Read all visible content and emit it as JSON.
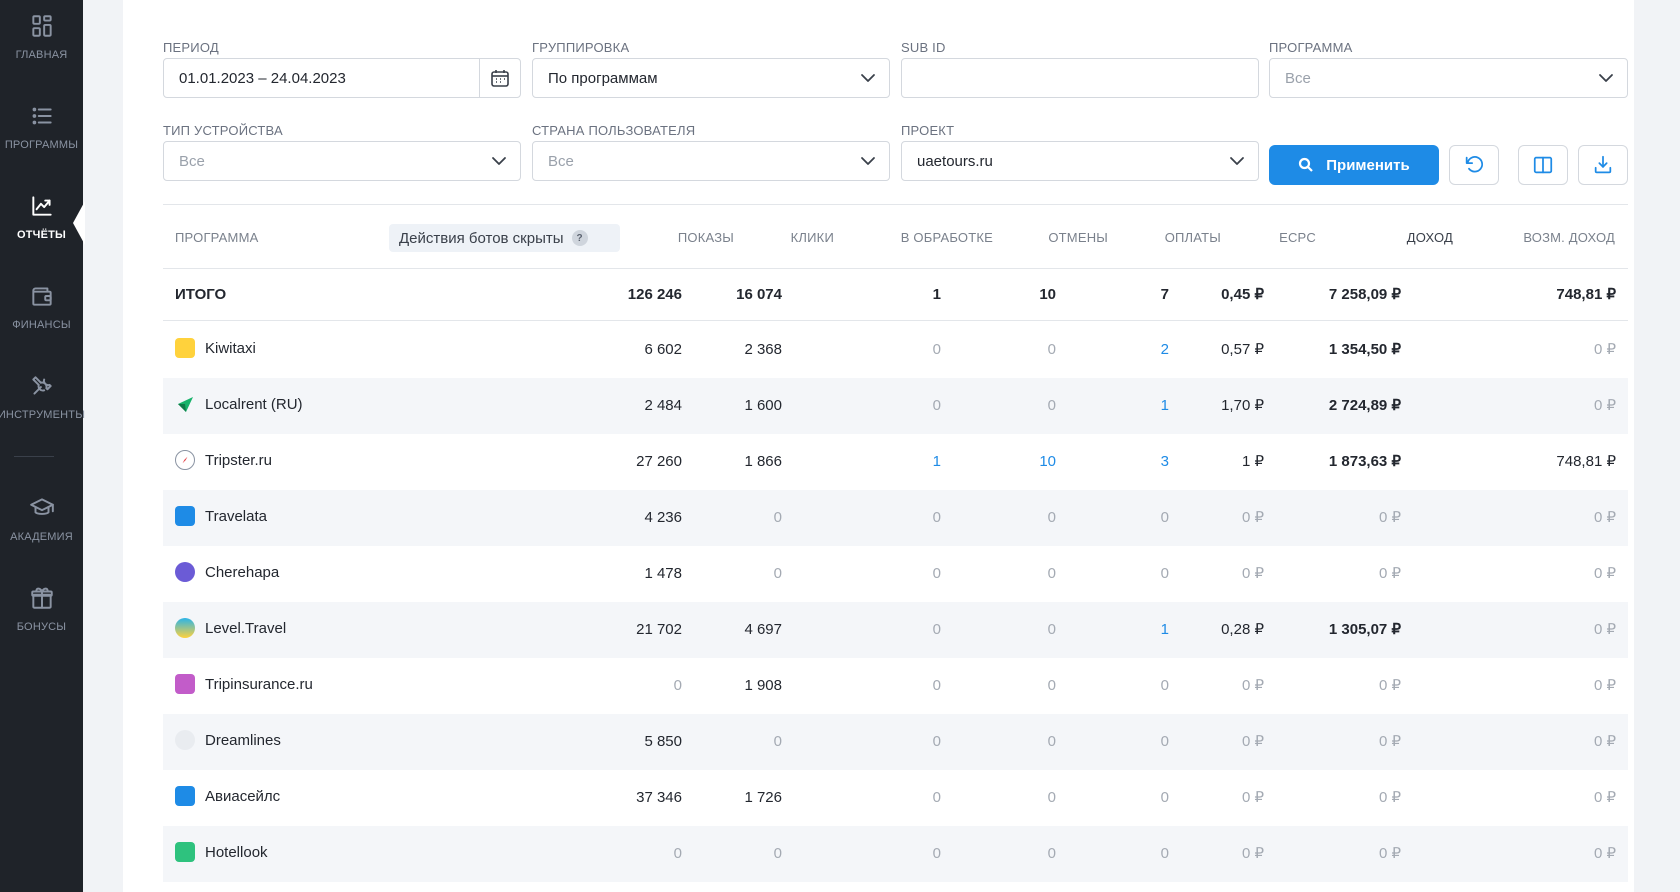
{
  "sidebar": {
    "items": [
      {
        "label": "ГЛАВНАЯ",
        "icon": "dashboard-icon"
      },
      {
        "label": "ПРОГРАММЫ",
        "icon": "list-icon"
      },
      {
        "label": "ОТЧЁТЫ",
        "icon": "chart-icon",
        "active": true
      },
      {
        "label": "ФИНАНСЫ",
        "icon": "wallet-icon"
      },
      {
        "label": "ИНСТРУМЕНТЫ",
        "icon": "tools-icon"
      },
      {
        "label": "АКАДЕМИЯ",
        "icon": "graduation-cap-icon"
      },
      {
        "label": "БОНУСЫ",
        "icon": "gift-icon"
      }
    ]
  },
  "filters": {
    "period": {
      "label": "ПЕРИОД",
      "value": "01.01.2023 – 24.04.2023"
    },
    "grouping": {
      "label": "ГРУППИРОВКА",
      "value": "По программам"
    },
    "subid": {
      "label": "SUB ID",
      "value": ""
    },
    "program": {
      "label": "ПРОГРАММА",
      "placeholder": "Все"
    },
    "device": {
      "label": "ТИП УСТРОЙСТВА",
      "placeholder": "Все"
    },
    "country": {
      "label": "СТРАНА ПОЛЬЗОВАТЕЛЯ",
      "placeholder": "Все"
    },
    "project": {
      "label": "ПРОЕКТ",
      "value": "uaetours.ru"
    },
    "apply_label": "Применить"
  },
  "table": {
    "headers": {
      "program": "ПРОГРАММА",
      "bots": "Действия ботов скрыты",
      "bots_hint": "?",
      "shows": "ПОКАЗЫ",
      "clicks": "КЛИКИ",
      "processing": "В ОБРАБОТКЕ",
      "cancels": "ОТМЕНЫ",
      "payments": "ОПЛАТЫ",
      "ecpc": "ECPC",
      "income": "ДОХОД",
      "possible_income": "ВОЗМ. ДОХОД"
    },
    "total": {
      "label": "ИТОГО",
      "shows": "126 246",
      "clicks": "16 074",
      "processing": "1",
      "cancels": "10",
      "payments": "7",
      "ecpc": "0,45 ₽",
      "income": "7 258,09 ₽",
      "possible_income": "748,81 ₽"
    },
    "rows": [
      {
        "name": "Kiwitaxi",
        "icon": "taxi-icon",
        "shows": "6 602",
        "clicks": "2 368",
        "processing": "0",
        "cancels": "0",
        "payments": "2",
        "ecpc": "0,57 ₽",
        "income": "1 354,50 ₽",
        "possible_income": "0 ₽"
      },
      {
        "name": "Localrent (RU)",
        "icon": "localrent-logo-icon",
        "shows": "2 484",
        "clicks": "1 600",
        "processing": "0",
        "cancels": "0",
        "payments": "1",
        "ecpc": "1,70 ₽",
        "income": "2 724,89 ₽",
        "possible_income": "0 ₽"
      },
      {
        "name": "Tripster.ru",
        "icon": "compass-icon",
        "shows": "27 260",
        "clicks": "1 866",
        "processing": "1",
        "cancels": "10",
        "payments": "3",
        "ecpc": "1 ₽",
        "income": "1 873,63 ₽",
        "possible_income": "748,81 ₽"
      },
      {
        "name": "Travelata",
        "icon": "travelata-logo-icon",
        "shows": "4 236",
        "clicks": "0",
        "processing": "0",
        "cancels": "0",
        "payments": "0",
        "ecpc": "0 ₽",
        "income": "0 ₽",
        "possible_income": "0 ₽"
      },
      {
        "name": "Cherehapa",
        "icon": "cherehapa-logo-icon",
        "shows": "1 478",
        "clicks": "0",
        "processing": "0",
        "cancels": "0",
        "payments": "0",
        "ecpc": "0 ₽",
        "income": "0 ₽",
        "possible_income": "0 ₽"
      },
      {
        "name": "Level.Travel",
        "icon": "level-travel-logo-icon",
        "shows": "21 702",
        "clicks": "4 697",
        "processing": "0",
        "cancels": "0",
        "payments": "1",
        "ecpc": "0,28 ₽",
        "income": "1 305,07 ₽",
        "possible_income": "0 ₽"
      },
      {
        "name": "Tripinsurance.ru",
        "icon": "tripinsurance-logo-icon",
        "shows": "0",
        "clicks": "1 908",
        "processing": "0",
        "cancels": "0",
        "payments": "0",
        "ecpc": "0 ₽",
        "income": "0 ₽",
        "possible_income": "0 ₽"
      },
      {
        "name": "Dreamlines",
        "icon": "dreamlines-logo-icon",
        "shows": "5 850",
        "clicks": "0",
        "processing": "0",
        "cancels": "0",
        "payments": "0",
        "ecpc": "0 ₽",
        "income": "0 ₽",
        "possible_income": "0 ₽"
      },
      {
        "name": "Авиасейлс",
        "icon": "aviasales-logo-icon",
        "shows": "37 346",
        "clicks": "1 726",
        "processing": "0",
        "cancels": "0",
        "payments": "0",
        "ecpc": "0 ₽",
        "income": "0 ₽",
        "possible_income": "0 ₽"
      },
      {
        "name": "Hotellook",
        "icon": "hotellook-logo-icon",
        "shows": "0",
        "clicks": "0",
        "processing": "0",
        "cancels": "0",
        "payments": "0",
        "ecpc": "0 ₽",
        "income": "0 ₽",
        "possible_income": "0 ₽"
      }
    ]
  },
  "colors": {
    "accent": "#1e8be6",
    "sidebar": "#1f2329",
    "muted": "#a4aab3"
  }
}
